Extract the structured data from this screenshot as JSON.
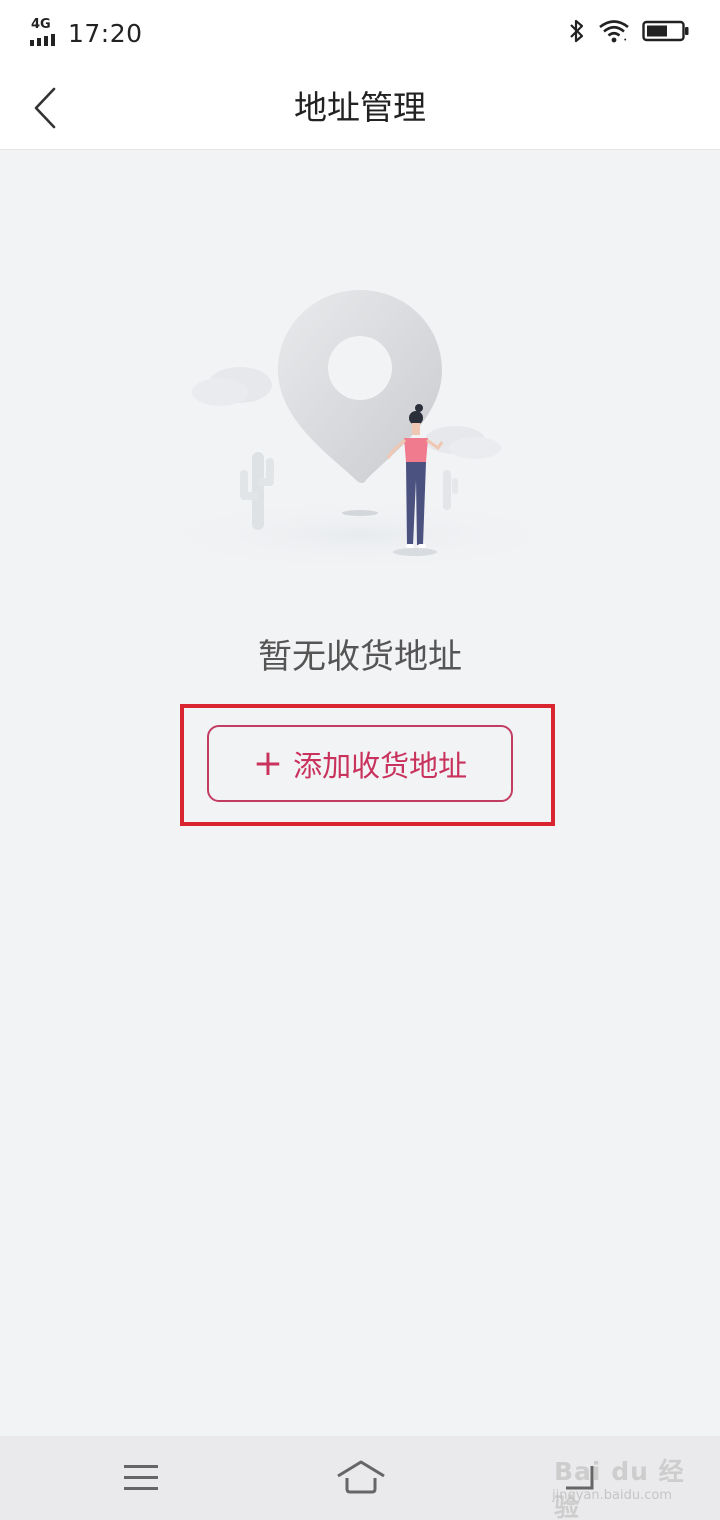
{
  "status_bar": {
    "network": "4G",
    "time": "17:20",
    "icons": [
      "signal-icon",
      "bluetooth-icon",
      "wifi-icon",
      "battery-icon"
    ]
  },
  "nav": {
    "back_icon": "chevron-left-icon",
    "title": "地址管理"
  },
  "empty_state": {
    "illustration": "location-pin-woman-illustration",
    "message": "暂无收货地址",
    "button_icon": "plus-icon",
    "button_label": "添加收货地址"
  },
  "system_nav": {
    "icons": [
      "menu-icon",
      "home-icon",
      "back-icon"
    ]
  },
  "watermark": {
    "line1": "Bai du 经验",
    "line2": "jingyan.baidu.com"
  },
  "colors": {
    "accent": "#c8325c",
    "highlight": "#d9252f",
    "background": "#f2f3f5"
  }
}
